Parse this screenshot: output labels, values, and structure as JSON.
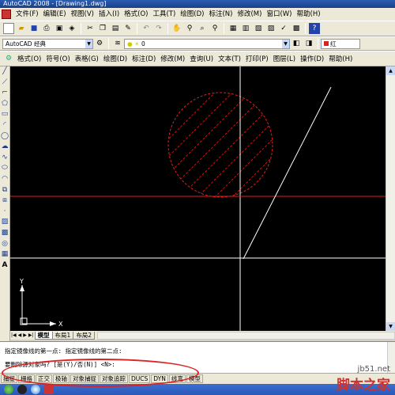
{
  "window": {
    "title": "AutoCAD 2008 - [Drawing1.dwg]"
  },
  "menubar": [
    "文件(F)",
    "编辑(E)",
    "视图(V)",
    "插入(I)",
    "格式(O)",
    "工具(T)",
    "绘图(D)",
    "标注(N)",
    "修改(M)",
    "窗口(W)",
    "帮助(H)"
  ],
  "toolbar2": {
    "workspace": "AutoCAD 经典",
    "layer": "0",
    "color": "红"
  },
  "toolbar3": [
    "格式(O)",
    "符号(O)",
    "表格(G)",
    "绘图(D)",
    "标注(D)",
    "修改(M)",
    "查询(U)",
    "文本(T)",
    "打印(P)",
    "图层(L)",
    "操作(D)",
    "帮助(H)"
  ],
  "canvas": {
    "ucs_x": "X",
    "ucs_y": "Y",
    "circle_color": "#e02020",
    "line_color": "#ffffff",
    "axis_red": "#e02020"
  },
  "tabs": [
    "模型",
    "布局1",
    "布局2"
  ],
  "command": {
    "line1": "指定镜像线的第一点: 指定镜像线的第二点:",
    "line2": "要删除源对象吗? [是(Y)/否(N)] <N>:"
  },
  "statusbar": [
    "捕捉",
    "栅格",
    "正交",
    "极轴",
    "对象捕捉",
    "对象追踪",
    "DUCS",
    "DYN",
    "线宽",
    "模型"
  ],
  "watermark": {
    "site": "jb51.net",
    "name": "脚本之家"
  }
}
